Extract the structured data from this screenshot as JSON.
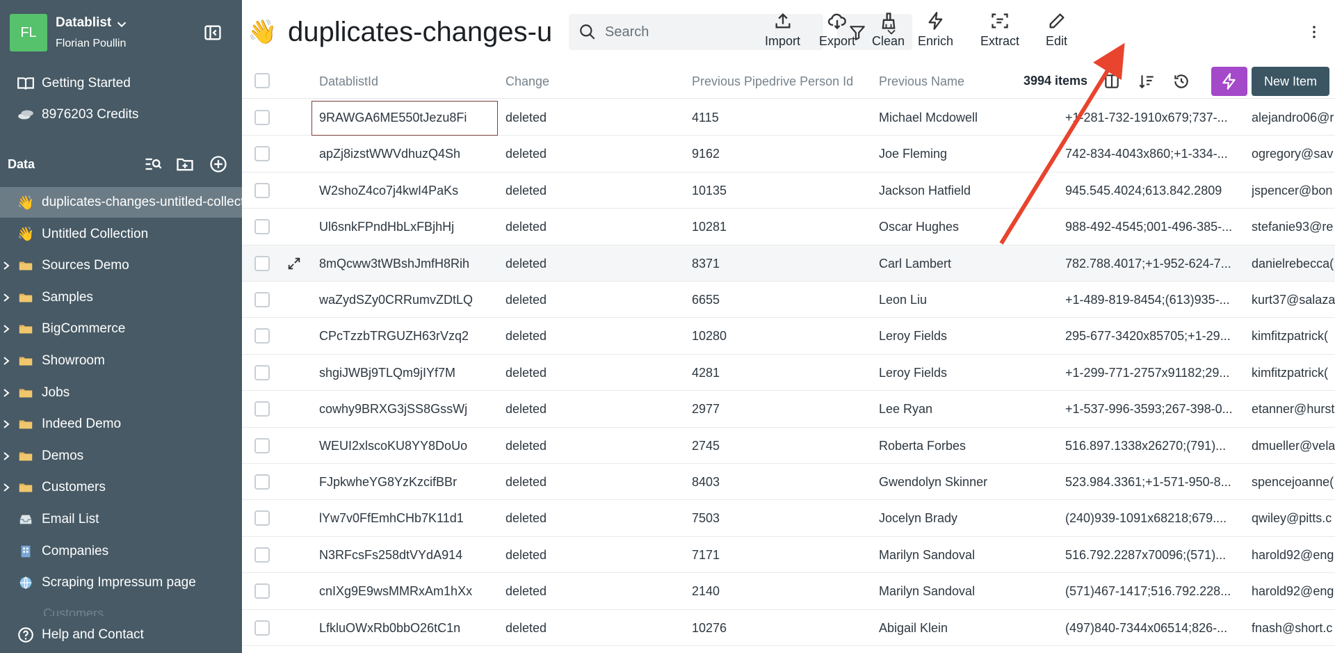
{
  "workspace": {
    "initials": "FL",
    "name": "Datablist",
    "user": "Florian Poullin"
  },
  "nav": {
    "getting_started": "Getting Started",
    "credits": "8976203 Credits",
    "data_label": "Data",
    "collections": [
      {
        "label": "duplicates-changes-untitled-collection",
        "icon": "wave-emoji",
        "type": "collection",
        "active": true
      },
      {
        "label": "Untitled Collection",
        "icon": "wave-emoji",
        "type": "collection"
      },
      {
        "label": "Sources Demo",
        "icon": "folder-icon",
        "type": "folder"
      },
      {
        "label": "Samples",
        "icon": "folder-icon",
        "type": "folder"
      },
      {
        "label": "BigCommerce",
        "icon": "folder-icon",
        "type": "folder"
      },
      {
        "label": "Showroom",
        "icon": "folder-icon",
        "type": "folder"
      },
      {
        "label": "Jobs",
        "icon": "folder-icon",
        "type": "folder"
      },
      {
        "label": "Indeed Demo",
        "icon": "folder-icon",
        "type": "folder"
      },
      {
        "label": "Demos",
        "icon": "folder-icon",
        "type": "folder"
      },
      {
        "label": "Customers",
        "icon": "folder-icon",
        "type": "folder"
      },
      {
        "label": "Email List",
        "icon": "inbox-icon",
        "type": "collection"
      },
      {
        "label": "Companies",
        "icon": "building-icon",
        "type": "collection"
      },
      {
        "label": "Scraping Impressum page",
        "icon": "globe-icon",
        "type": "collection"
      }
    ],
    "faded_item": "Customers",
    "help": "Help and Contact"
  },
  "header": {
    "emoji": "👋",
    "title": "duplicates-changes-unt",
    "search_placeholder": "Search",
    "actions": [
      "Import",
      "Export",
      "Clean",
      "Enrich",
      "Extract",
      "Edit"
    ]
  },
  "table": {
    "columns": [
      "DatablistId",
      "Change",
      "Previous Pipedrive Person Id",
      "Previous Name"
    ],
    "items_count": "3994 items",
    "new_item": "New Item",
    "rows": [
      [
        "9RAWGA6ME550tJezu8Fi",
        "deleted",
        "4115",
        "Michael Mcdowell",
        "+1-281-732-1910x679;737-...",
        "alejandro06@r"
      ],
      [
        "apZj8izstWWVdhuzQ4Sh",
        "deleted",
        "9162",
        "Joe Fleming",
        "742-834-4043x860;+1-334-...",
        "ogregory@sav"
      ],
      [
        "W2shoZ4co7j4kwI4PaKs",
        "deleted",
        "10135",
        "Jackson Hatfield",
        "945.545.4024;613.842.2809",
        "jspencer@bon"
      ],
      [
        "Ul6snkFPndHbLxFBjhHj",
        "deleted",
        "10281",
        "Oscar Hughes",
        "988-492-4545;001-496-385-...",
        "stefanie93@re"
      ],
      [
        "8mQcww3tWBshJmfH8Rih",
        "deleted",
        "8371",
        "Carl Lambert",
        "782.788.4017;+1-952-624-7...",
        "danielrebecca("
      ],
      [
        "waZydSZy0CRRumvZDtLQ",
        "deleted",
        "6655",
        "Leon Liu",
        "+1-489-819-8454;(613)935-...",
        "kurt37@salaza"
      ],
      [
        "CPcTzzbTRGUZH63rVzq2",
        "deleted",
        "10280",
        "Leroy Fields",
        "295-677-3420x85705;+1-29...",
        "kimfitzpatrick("
      ],
      [
        "shgiJWBj9TLQm9jIYf7M",
        "deleted",
        "4281",
        "Leroy Fields",
        "+1-299-771-2757x91182;29...",
        "kimfitzpatrick("
      ],
      [
        "cowhy9BRXG3jSS8GssWj",
        "deleted",
        "2977",
        "Lee Ryan",
        "+1-537-996-3593;267-398-0...",
        "etanner@hurst"
      ],
      [
        "WEUI2xlscoKU8YY8DoUo",
        "deleted",
        "2745",
        "Roberta Forbes",
        "516.897.1338x26270;(791)...",
        "dmueller@vela"
      ],
      [
        "FJpkwheYG8YzKzcifBBr",
        "deleted",
        "8403",
        "Gwendolyn Skinner",
        "523.984.3361;+1-571-950-8...",
        "spencejoanne("
      ],
      [
        "lYw7v0FfEmhCHb7K11d1",
        "deleted",
        "7503",
        "Jocelyn Brady",
        "(240)939-1091x68218;679....",
        "qwiley@pitts.c"
      ],
      [
        "N3RFcsFs258dtVYdA914",
        "deleted",
        "7171",
        "Marilyn Sandoval",
        "516.792.2287x70096;(571)...",
        "harold92@eng"
      ],
      [
        "cnIXg9E9wsMMRxAm1hXx",
        "deleted",
        "2140",
        "Marilyn Sandoval",
        "(571)467-1417;516.792.228...",
        "harold92@eng"
      ],
      [
        "LfkluOWxRb0bbO26tC1n",
        "deleted",
        "10276",
        "Abigail Klein",
        "(497)840-7344x06514;826-...",
        "fnash@short.c"
      ]
    ],
    "focused_row": 0,
    "hover_row": 4
  },
  "colors": {
    "sidebar": "#475a65",
    "active_item": "#6b7c86",
    "accent_purple": "#a349c9",
    "primary": "#3b5562",
    "annotation_arrow": "#e8442e"
  }
}
